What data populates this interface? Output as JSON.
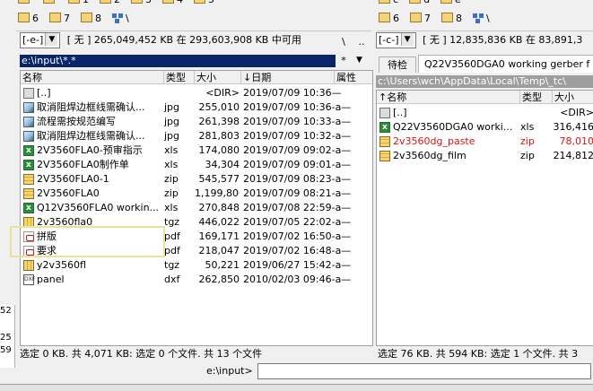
{
  "left": {
    "drives": [
      "6",
      "7",
      "8",
      "\\"
    ],
    "top_drives_partial": [
      "",
      "",
      "1",
      "2",
      "3",
      "4",
      "5"
    ],
    "drive_combo": "[-e-]",
    "free_space": "[ 无 ]  265,049,452 KB 在 293,603,908 KB 中可用",
    "root_btn": "\\",
    "up_btn": "..",
    "path": "e:\\input\\*.*",
    "star": "*",
    "columns": {
      "name": "名称",
      "type": "类型",
      "size": "大小",
      "date": "↓日期",
      "attr": "属性"
    },
    "files": [
      {
        "icon": "up",
        "name": "[..]",
        "type": "",
        "size": "<DIR>",
        "date": "2019/07/09 10:36—"
      },
      {
        "icon": "img",
        "name": "取消阻焊边框线需确认...",
        "type": "jpg",
        "size": "255,010",
        "date": "2019/07/09 10:36-a—"
      },
      {
        "icon": "img",
        "name": "流程需按规范编写",
        "type": "jpg",
        "size": "261,398",
        "date": "2019/07/09 10:33-a—"
      },
      {
        "icon": "img",
        "name": "取消阻焊边框线需确认...",
        "type": "jpg",
        "size": "281,803",
        "date": "2019/07/09 10:32-a—"
      },
      {
        "icon": "xls",
        "name": "2V3560FLA0-预审指示",
        "type": "xls",
        "size": "174,080",
        "date": "2019/07/09 09:02-a—"
      },
      {
        "icon": "xls",
        "name": "2V3560FLA0制作单",
        "type": "xls",
        "size": "34,304",
        "date": "2019/07/09 09:01-a—"
      },
      {
        "icon": "zip",
        "name": "2V3560FLA0-1",
        "type": "zip",
        "size": "545,577",
        "date": "2019/07/09 08:23-a—"
      },
      {
        "icon": "zip",
        "name": "2V3560FLA0",
        "type": "zip",
        "size": "1,199,806",
        "date": "2019/07/09 08:21-a—"
      },
      {
        "icon": "xls",
        "name": "Q12V3560FLA0 workin...",
        "type": "xls",
        "size": "270,848",
        "date": "2019/07/08 22:59-a—"
      },
      {
        "icon": "tgz",
        "name": "2v3560fla0",
        "type": "tgz",
        "size": "446,022",
        "date": "2019/07/05 22:02-a—"
      },
      {
        "icon": "pdf",
        "name": "拼版",
        "type": "pdf",
        "size": "169,171",
        "date": "2019/07/02 16:50-a—"
      },
      {
        "icon": "pdf",
        "name": "要求",
        "type": "pdf",
        "size": "218,047",
        "date": "2019/07/02 16:48-a—"
      },
      {
        "icon": "tgz",
        "name": "y2v3560fl",
        "type": "tgz",
        "size": "50,221",
        "date": "2019/06/27 15:42-a—"
      },
      {
        "icon": "dxf",
        "name": "panel",
        "type": "dxf",
        "size": "262,850",
        "date": "2010/02/03 09:46-a—"
      }
    ],
    "status": "选定 0 KB. 共 4,071 KB: 选定 0 个文件. 共 13 个文件"
  },
  "right": {
    "drives": [
      "6",
      "7",
      "8",
      "\\"
    ],
    "top_drives_partial": [
      "c",
      "d",
      "e"
    ],
    "drive_combo": "[-c-]",
    "free_space": "[ 无 ]  12,835,836 KB 在 83,891,3",
    "tab_waiting": "待检",
    "tab_active": "Q22V3560DGA0 working gerber f",
    "path": "c:\\Users\\wch\\AppData\\Local\\Temp\\_tc\\",
    "columns": {
      "name": "↑名称",
      "type": "类型",
      "size": "大小"
    },
    "files": [
      {
        "icon": "up",
        "name": "[..]",
        "type": "",
        "size": "<DIR>",
        "red": false
      },
      {
        "icon": "xls",
        "name": "Q22V3560DGA0 worki...",
        "type": "xls",
        "size": "316,416",
        "red": false
      },
      {
        "icon": "zip",
        "name": "2v3560dg_paste",
        "type": "zip",
        "size": "78,010",
        "red": true
      },
      {
        "icon": "zip",
        "name": "2v3560dg_film",
        "type": "zip",
        "size": "214,812",
        "red": false
      }
    ],
    "status": "选定 76 KB. 共 594 KB: 选定 1 个文件. 共 3"
  },
  "cmd_label": "e:\\input>",
  "cmd_value": "",
  "left_edge_times": [
    "52",
    "25",
    "59"
  ]
}
